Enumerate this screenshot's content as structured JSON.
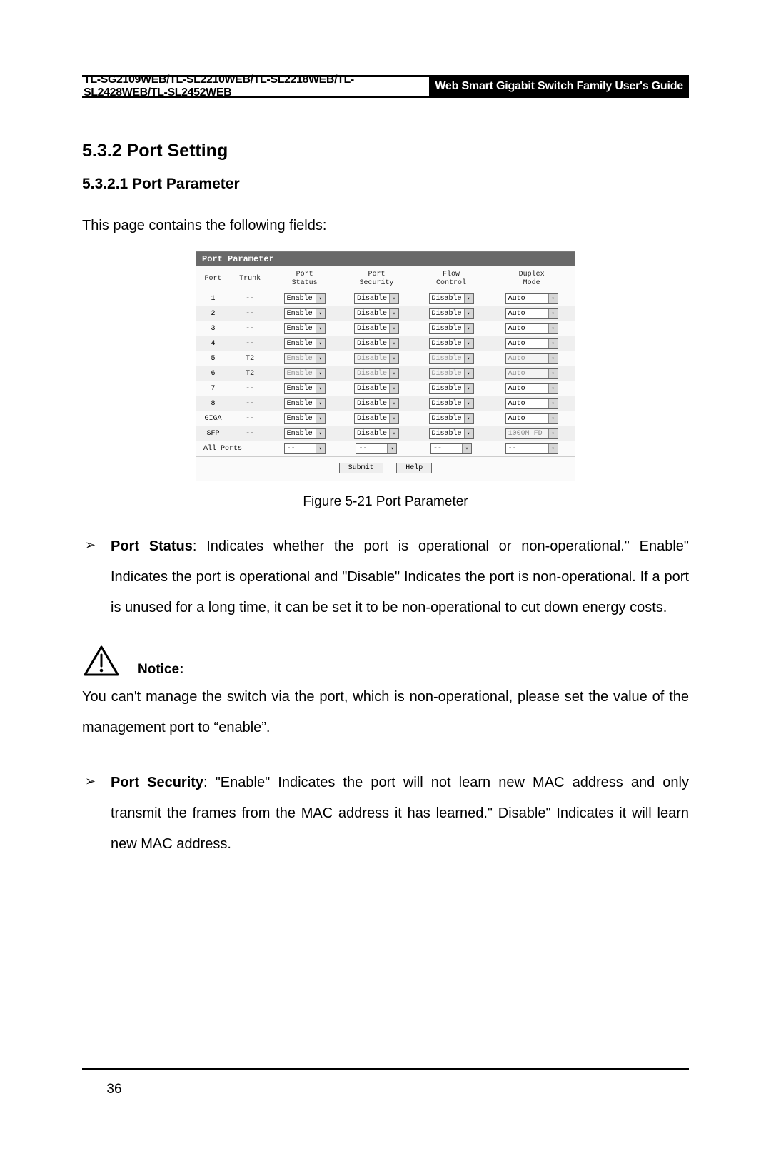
{
  "header": {
    "models": "TL-SG2109WEB/TL-SL2210WEB/TL-SL2218WEB/TL-SL2428WEB/TL-SL2452WEB",
    "guide": "Web Smart Gigabit Switch Family User's Guide"
  },
  "section": {
    "h2": "5.3.2  Port Setting",
    "h3": "5.3.2.1  Port Parameter",
    "intro": "This page contains the following fields:"
  },
  "shot": {
    "title": "Port Parameter",
    "cols": {
      "port": "Port",
      "trunk": "Trunk",
      "status": "Port\nStatus",
      "security": "Port\nSecurity",
      "flow": "Flow\nControl",
      "duplex": "Duplex\nMode"
    },
    "rows": [
      {
        "port": "1",
        "trunk": "--",
        "status": "Enable",
        "security": "Disable",
        "flow": "Disable",
        "duplex": "Auto",
        "grey": false
      },
      {
        "port": "2",
        "trunk": "--",
        "status": "Enable",
        "security": "Disable",
        "flow": "Disable",
        "duplex": "Auto",
        "grey": false
      },
      {
        "port": "3",
        "trunk": "--",
        "status": "Enable",
        "security": "Disable",
        "flow": "Disable",
        "duplex": "Auto",
        "grey": false
      },
      {
        "port": "4",
        "trunk": "--",
        "status": "Enable",
        "security": "Disable",
        "flow": "Disable",
        "duplex": "Auto",
        "grey": false
      },
      {
        "port": "5",
        "trunk": "T2",
        "status": "Enable",
        "security": "Disable",
        "flow": "Disable",
        "duplex": "Auto",
        "grey": true
      },
      {
        "port": "6",
        "trunk": "T2",
        "status": "Enable",
        "security": "Disable",
        "flow": "Disable",
        "duplex": "Auto",
        "grey": true
      },
      {
        "port": "7",
        "trunk": "--",
        "status": "Enable",
        "security": "Disable",
        "flow": "Disable",
        "duplex": "Auto",
        "grey": false
      },
      {
        "port": "8",
        "trunk": "--",
        "status": "Enable",
        "security": "Disable",
        "flow": "Disable",
        "duplex": "Auto",
        "grey": false
      },
      {
        "port": "GIGA",
        "trunk": "--",
        "status": "Enable",
        "security": "Disable",
        "flow": "Disable",
        "duplex": "Auto",
        "grey": false
      },
      {
        "port": "SFP",
        "trunk": "--",
        "status": "Enable",
        "security": "Disable",
        "flow": "Disable",
        "duplex": "1000M FD",
        "grey": false,
        "duplex_grey": true
      }
    ],
    "allports_label": "All Ports",
    "dash": "--",
    "submit": "Submit",
    "help": "Help"
  },
  "caption": "Figure 5-21  Port Parameter",
  "bullets": {
    "status_label": "Port Status",
    "status_text": ": Indicates whether the port is operational or non-operational.\" Enable\" Indicates the port is operational and \"Disable\" Indicates the port is non-operational. If a port is unused for a long time, it can be set it to be non-operational to cut down energy costs.",
    "security_label": "Port Security",
    "security_text": ":  \"Enable\" Indicates the port will not learn new MAC address and only transmit the frames from the MAC address it has learned.\" Disable\" Indicates it will learn new MAC address."
  },
  "notice": {
    "label": "Notice:",
    "body": "You can't manage the switch via the port, which is non-operational, please set the value of the management port to “enable”."
  },
  "page_number": "36"
}
